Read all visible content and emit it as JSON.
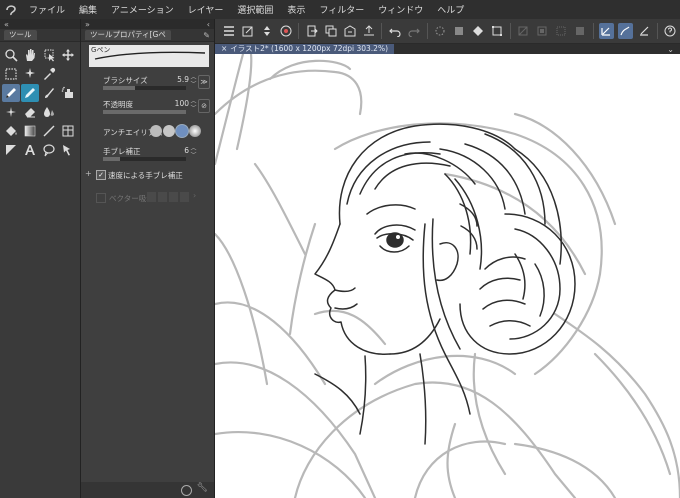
{
  "menu": {
    "items": [
      "ファイル",
      "編集",
      "アニメーション",
      "レイヤー",
      "選択範囲",
      "表示",
      "フィルター",
      "ウィンドウ",
      "ヘルプ"
    ]
  },
  "tool_panel": {
    "tab_label": "ツール",
    "tools": [
      {
        "name": "zoom-icon",
        "glyph": "magnifier"
      },
      {
        "name": "hand-icon",
        "glyph": "hand"
      },
      {
        "name": "operation-icon",
        "glyph": "pointer"
      },
      {
        "name": "move-layer-icon",
        "glyph": "move"
      },
      {
        "name": "selection-icon",
        "glyph": "marquee"
      },
      {
        "name": "auto-select-icon",
        "glyph": "wand"
      },
      {
        "name": "eyedropper-icon",
        "glyph": "dropper"
      },
      {
        "name": "blank-icon",
        "glyph": "none"
      },
      {
        "name": "pen-icon",
        "glyph": "pen",
        "active": true
      },
      {
        "name": "pencil-icon",
        "glyph": "pencil"
      },
      {
        "name": "brush-icon",
        "glyph": "brush"
      },
      {
        "name": "airbrush-icon",
        "glyph": "airbrush"
      },
      {
        "name": "decoration-icon",
        "glyph": "sparkle"
      },
      {
        "name": "eraser-icon",
        "glyph": "eraser"
      },
      {
        "name": "blend-icon",
        "glyph": "drop"
      },
      {
        "name": "blank2-icon",
        "glyph": "none"
      },
      {
        "name": "fill-icon",
        "glyph": "bucket"
      },
      {
        "name": "gradient-icon",
        "glyph": "gradient"
      },
      {
        "name": "figure-icon",
        "glyph": "line"
      },
      {
        "name": "frame-border-icon",
        "glyph": "frame"
      },
      {
        "name": "ruler-icon",
        "glyph": "ruler"
      },
      {
        "name": "text-icon",
        "glyph": "text"
      },
      {
        "name": "balloon-icon",
        "glyph": "balloon"
      },
      {
        "name": "correct-line-icon",
        "glyph": "correct"
      }
    ]
  },
  "tool_property": {
    "tab_label": "ツールプロパティ[Gペ",
    "brush_name": "Gペン",
    "brush_size_label": "ブラシサイズ",
    "brush_size_value": "5.9",
    "brush_size_fraction": 0.38,
    "opacity_label": "不透明度",
    "opacity_value": "100",
    "opacity_fraction": 1.0,
    "antialias_label": "アンチエイリアス",
    "stabilization_label": "手ブレ補正",
    "stabilization_value": "6",
    "stabilization_fraction": 0.2,
    "speed_stabilization_label": "速度による手ブレ補正",
    "vector_snap_label": "ベクター吸着"
  },
  "document": {
    "tab_label": "イラスト2* (1600 x 1200px 72dpi 303.2%)"
  },
  "colors": {
    "accent": "#55719a",
    "canvas": "#ffffff",
    "sketch": "#b5b5b5",
    "lineart": "#2e2e2e"
  }
}
